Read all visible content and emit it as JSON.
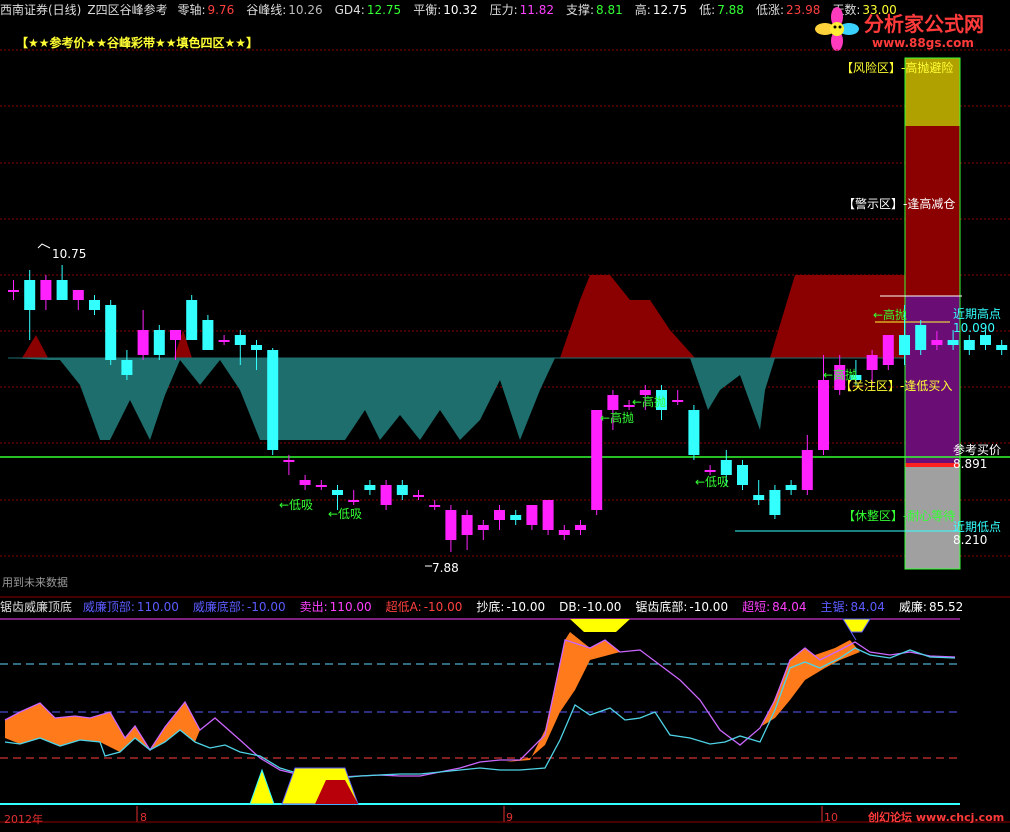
{
  "header": {
    "broker": "西南证券(日线)",
    "indicator": "Z四区谷峰参考",
    "items": [
      {
        "label": "零轴:",
        "value": "9.76",
        "color": "#ff4040"
      },
      {
        "label": "谷峰线:",
        "value": "10.26",
        "color": "#bbbbbb"
      },
      {
        "label": "GD4:",
        "value": "12.75",
        "color": "#33ff33"
      },
      {
        "label": "平衡:",
        "value": "10.32",
        "color": "#ffffff"
      },
      {
        "label": "压力:",
        "value": "11.82",
        "color": "#ff40ff"
      },
      {
        "label": "支撑:",
        "value": "8.81",
        "color": "#33ff33"
      },
      {
        "label": "高:",
        "value": "12.75",
        "color": "#ffffff"
      },
      {
        "label": "低:",
        "value": "7.88",
        "color": "#33ff33"
      },
      {
        "label": "低涨:",
        "value": "23.98",
        "color": "#ff4040"
      },
      {
        "label": "天数:",
        "value": "33.00",
        "color": "#ffff33"
      }
    ]
  },
  "subtitle": "【★★参考价★★谷峰彩带★★填色四区★★】",
  "logo": {
    "name": "分析家公式网",
    "url": "www.88gs.com"
  },
  "zones": {
    "risk": "【风险区】-高抛避险",
    "warn": "【警示区】-逢高减仓",
    "focus": "【关注区】-逢低买入",
    "rest": "【休整区】-耐心等待"
  },
  "right_labels": {
    "recent_high": "近期高点",
    "recent_high_value": "10.090",
    "ref_buy": "参考买价",
    "ref_buy_value": "8.891",
    "recent_low": "近期低点",
    "recent_low_value": "8.210"
  },
  "annotations": {
    "high_price": "10.75",
    "low_price": "7.88",
    "sell1": "←高抛",
    "sell2": "←高抛",
    "sell3": "←高抛",
    "sell4": "←高抛",
    "buy1": "←低吸",
    "buy2": "←低吸",
    "buy3": "←低吸",
    "no_future": "用到未来数据"
  },
  "indicator": {
    "name": "锯齿威廉顶底",
    "items": [
      {
        "label": "威廉顶部:",
        "value": "110.00",
        "color": "#5b5bff"
      },
      {
        "label": "威廉底部:",
        "value": "-10.00",
        "color": "#5b5bff"
      },
      {
        "label": "卖出:",
        "value": "110.00",
        "color": "#ff40ff"
      },
      {
        "label": "超低A:",
        "value": "-10.00",
        "color": "#ff4040"
      },
      {
        "label": "抄底:",
        "value": "-10.00",
        "color": "#ffffff"
      },
      {
        "label": "DB:",
        "value": "-10.00",
        "color": "#ffffff"
      },
      {
        "label": "锯齿底部:",
        "value": "-10.00",
        "color": "#ffffff"
      },
      {
        "label": "超短:",
        "value": "84.04",
        "color": "#ff40ff"
      },
      {
        "label": "主锯:",
        "value": "84.04",
        "color": "#5b5bff"
      },
      {
        "label": "威廉:",
        "value": "85.52",
        "color": "#ffffff"
      }
    ]
  },
  "dates": [
    {
      "label": "2012年"
    },
    {
      "label": "8"
    },
    {
      "label": "9"
    },
    {
      "label": "10"
    }
  ],
  "watermark": "创幻论坛 www.chcj.com",
  "chart_data": {
    "type": "candlestick",
    "price_range": [
      7.6,
      12.9
    ],
    "candles": [
      {
        "o": 10.5,
        "h": 10.6,
        "l": 10.4,
        "c": 10.5
      },
      {
        "o": 10.6,
        "h": 10.7,
        "l": 10.0,
        "c": 10.3
      },
      {
        "o": 10.4,
        "h": 10.65,
        "l": 10.3,
        "c": 10.6
      },
      {
        "o": 10.6,
        "h": 10.75,
        "l": 10.4,
        "c": 10.4
      },
      {
        "o": 10.4,
        "h": 10.5,
        "l": 10.3,
        "c": 10.5
      },
      {
        "o": 10.4,
        "h": 10.45,
        "l": 10.25,
        "c": 10.3
      },
      {
        "o": 10.35,
        "h": 10.4,
        "l": 9.75,
        "c": 9.8
      },
      {
        "o": 9.8,
        "h": 9.9,
        "l": 9.6,
        "c": 9.65
      },
      {
        "o": 9.85,
        "h": 10.3,
        "l": 9.8,
        "c": 10.1
      },
      {
        "o": 10.1,
        "h": 10.15,
        "l": 9.8,
        "c": 9.85
      },
      {
        "o": 10.0,
        "h": 10.05,
        "l": 9.8,
        "c": 10.1
      },
      {
        "o": 10.4,
        "h": 10.45,
        "l": 10.0,
        "c": 10.0
      },
      {
        "o": 10.2,
        "h": 10.25,
        "l": 9.9,
        "c": 9.9
      },
      {
        "o": 10.0,
        "h": 10.05,
        "l": 9.95,
        "c": 10.0
      },
      {
        "o": 10.05,
        "h": 10.1,
        "l": 9.75,
        "c": 9.95
      },
      {
        "o": 9.95,
        "h": 10.0,
        "l": 9.7,
        "c": 9.9
      },
      {
        "o": 9.9,
        "h": 9.92,
        "l": 8.85,
        "c": 8.9
      },
      {
        "o": 8.8,
        "h": 8.85,
        "l": 8.65,
        "c": 8.8
      },
      {
        "o": 8.55,
        "h": 8.65,
        "l": 8.5,
        "c": 8.6
      },
      {
        "o": 8.55,
        "h": 8.6,
        "l": 8.5,
        "c": 8.55
      },
      {
        "o": 8.5,
        "h": 8.55,
        "l": 8.3,
        "c": 8.45
      },
      {
        "o": 8.4,
        "h": 8.5,
        "l": 8.35,
        "c": 8.4
      },
      {
        "o": 8.55,
        "h": 8.6,
        "l": 8.45,
        "c": 8.5
      },
      {
        "o": 8.35,
        "h": 8.6,
        "l": 8.3,
        "c": 8.55
      },
      {
        "o": 8.55,
        "h": 8.6,
        "l": 8.4,
        "c": 8.45
      },
      {
        "o": 8.45,
        "h": 8.5,
        "l": 8.4,
        "c": 8.45
      },
      {
        "o": 8.35,
        "h": 8.4,
        "l": 8.3,
        "c": 8.35
      },
      {
        "o": 8.0,
        "h": 8.35,
        "l": 7.88,
        "c": 8.3
      },
      {
        "o": 8.05,
        "h": 8.3,
        "l": 7.9,
        "c": 8.25
      },
      {
        "o": 8.1,
        "h": 8.2,
        "l": 8.0,
        "c": 8.15
      },
      {
        "o": 8.2,
        "h": 8.35,
        "l": 8.1,
        "c": 8.3
      },
      {
        "o": 8.25,
        "h": 8.3,
        "l": 8.15,
        "c": 8.2
      },
      {
        "o": 8.15,
        "h": 8.35,
        "l": 8.1,
        "c": 8.35
      },
      {
        "o": 8.1,
        "h": 8.4,
        "l": 8.05,
        "c": 8.4
      },
      {
        "o": 8.05,
        "h": 8.15,
        "l": 8.0,
        "c": 8.1
      },
      {
        "o": 8.1,
        "h": 8.2,
        "l": 8.05,
        "c": 8.15
      },
      {
        "o": 8.3,
        "h": 9.3,
        "l": 8.25,
        "c": 9.3
      },
      {
        "o": 9.3,
        "h": 9.5,
        "l": 9.1,
        "c": 9.45
      },
      {
        "o": 9.35,
        "h": 9.4,
        "l": 9.3,
        "c": 9.35
      },
      {
        "o": 9.45,
        "h": 9.55,
        "l": 9.3,
        "c": 9.5
      },
      {
        "o": 9.5,
        "h": 9.55,
        "l": 9.2,
        "c": 9.3
      },
      {
        "o": 9.4,
        "h": 9.5,
        "l": 9.35,
        "c": 9.4
      },
      {
        "o": 9.3,
        "h": 9.35,
        "l": 8.8,
        "c": 8.85
      },
      {
        "o": 8.7,
        "h": 8.75,
        "l": 8.65,
        "c": 8.7
      },
      {
        "o": 8.8,
        "h": 8.9,
        "l": 8.55,
        "c": 8.65
      },
      {
        "o": 8.75,
        "h": 8.8,
        "l": 8.5,
        "c": 8.55
      },
      {
        "o": 8.45,
        "h": 8.6,
        "l": 8.35,
        "c": 8.4
      },
      {
        "o": 8.5,
        "h": 8.55,
        "l": 8.21,
        "c": 8.25
      },
      {
        "o": 8.55,
        "h": 8.6,
        "l": 8.45,
        "c": 8.5
      },
      {
        "o": 8.5,
        "h": 9.05,
        "l": 8.45,
        "c": 8.9
      },
      {
        "o": 8.9,
        "h": 9.85,
        "l": 8.85,
        "c": 9.6
      },
      {
        "o": 9.5,
        "h": 9.85,
        "l": 9.45,
        "c": 9.75
      },
      {
        "o": 9.65,
        "h": 9.8,
        "l": 9.55,
        "c": 9.6
      },
      {
        "o": 9.7,
        "h": 9.9,
        "l": 9.55,
        "c": 9.85
      },
      {
        "o": 9.75,
        "h": 10.0,
        "l": 9.7,
        "c": 10.05
      },
      {
        "o": 10.05,
        "h": 10.35,
        "l": 9.75,
        "c": 9.85
      },
      {
        "o": 10.15,
        "h": 10.2,
        "l": 9.85,
        "c": 9.9
      },
      {
        "o": 9.95,
        "h": 10.09,
        "l": 9.9,
        "c": 10.0
      },
      {
        "o": 10.0,
        "h": 10.1,
        "l": 9.9,
        "c": 9.95
      },
      {
        "o": 10.0,
        "h": 10.05,
        "l": 9.85,
        "c": 9.9
      },
      {
        "o": 10.05,
        "h": 10.1,
        "l": 9.9,
        "c": 9.95
      },
      {
        "o": 9.95,
        "h": 10.0,
        "l": 9.85,
        "c": 9.9
      }
    ]
  }
}
